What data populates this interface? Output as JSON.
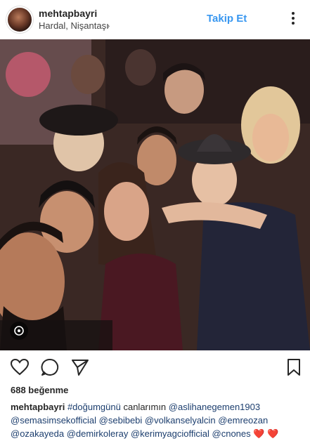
{
  "post": {
    "username": "mehtapbayri",
    "location": "Hardal, Nişantaşı",
    "follow_label": "Takip Et",
    "likes_text": "688 beğenme",
    "caption": {
      "username": "mehtapbayri",
      "hashtag": "#doğumgünü",
      "text": "canlarımın",
      "mentions": [
        "@aslihanegemen1903",
        "@semasimsekofficial",
        "@sebibebi",
        "@volkanselyalcin",
        "@emreozan",
        "@ozakayeda",
        "@demirkoleray",
        "@kerimyagciofficial",
        "@cnones"
      ],
      "emoji_heart": "❤️"
    }
  },
  "icons": {
    "location_chevron": "chevron-right-icon",
    "more": "more-vertical-icon",
    "like": "heart-outline-icon",
    "comment": "comment-bubble-icon",
    "share": "send-arrow-icon",
    "save": "bookmark-icon",
    "video": "video-indicator-icon"
  },
  "colors": {
    "follow_blue": "#3897f0",
    "mention_blue": "#1c3e6e",
    "heart_red": "#e0203a"
  }
}
